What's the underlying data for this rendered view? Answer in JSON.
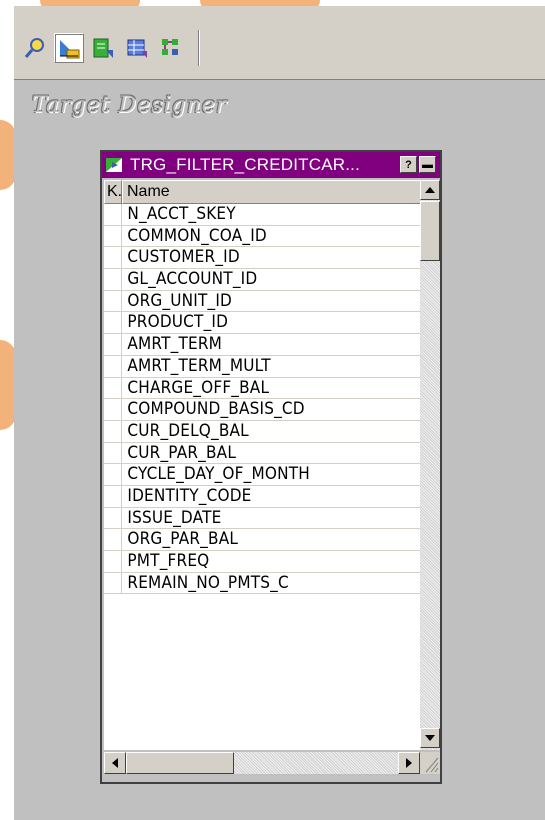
{
  "toolbar": {
    "tools": [
      {
        "icon": "source-analyzer-icon"
      },
      {
        "icon": "target-designer-icon",
        "active": true
      },
      {
        "icon": "transformation-developer-icon"
      },
      {
        "icon": "mapplet-designer-icon"
      },
      {
        "icon": "mapping-designer-icon"
      }
    ]
  },
  "workspace": {
    "title": "Target Designer"
  },
  "table": {
    "title": "TRG_FILTER_CREDITCAR...",
    "help_glyph": "?",
    "minimize_glyph": "▬",
    "columns": {
      "key": "K.",
      "name": "Name"
    },
    "rows": [
      "N_ACCT_SKEY",
      "COMMON_COA_ID",
      "CUSTOMER_ID",
      "GL_ACCOUNT_ID",
      "ORG_UNIT_ID",
      "PRODUCT_ID",
      "AMRT_TERM",
      "AMRT_TERM_MULT",
      "CHARGE_OFF_BAL",
      "COMPOUND_BASIS_CD",
      "CUR_DELQ_BAL",
      "CUR_PAR_BAL",
      "CYCLE_DAY_OF_MONTH",
      "IDENTITY_CODE",
      "ISSUE_DATE",
      "ORG_PAR_BAL",
      "PMT_FREQ",
      "REMAIN_NO_PMTS_C"
    ]
  },
  "colors": {
    "titlebar": "#800080",
    "workspace": "#c0c0c0",
    "decor": "#f3b27a"
  }
}
